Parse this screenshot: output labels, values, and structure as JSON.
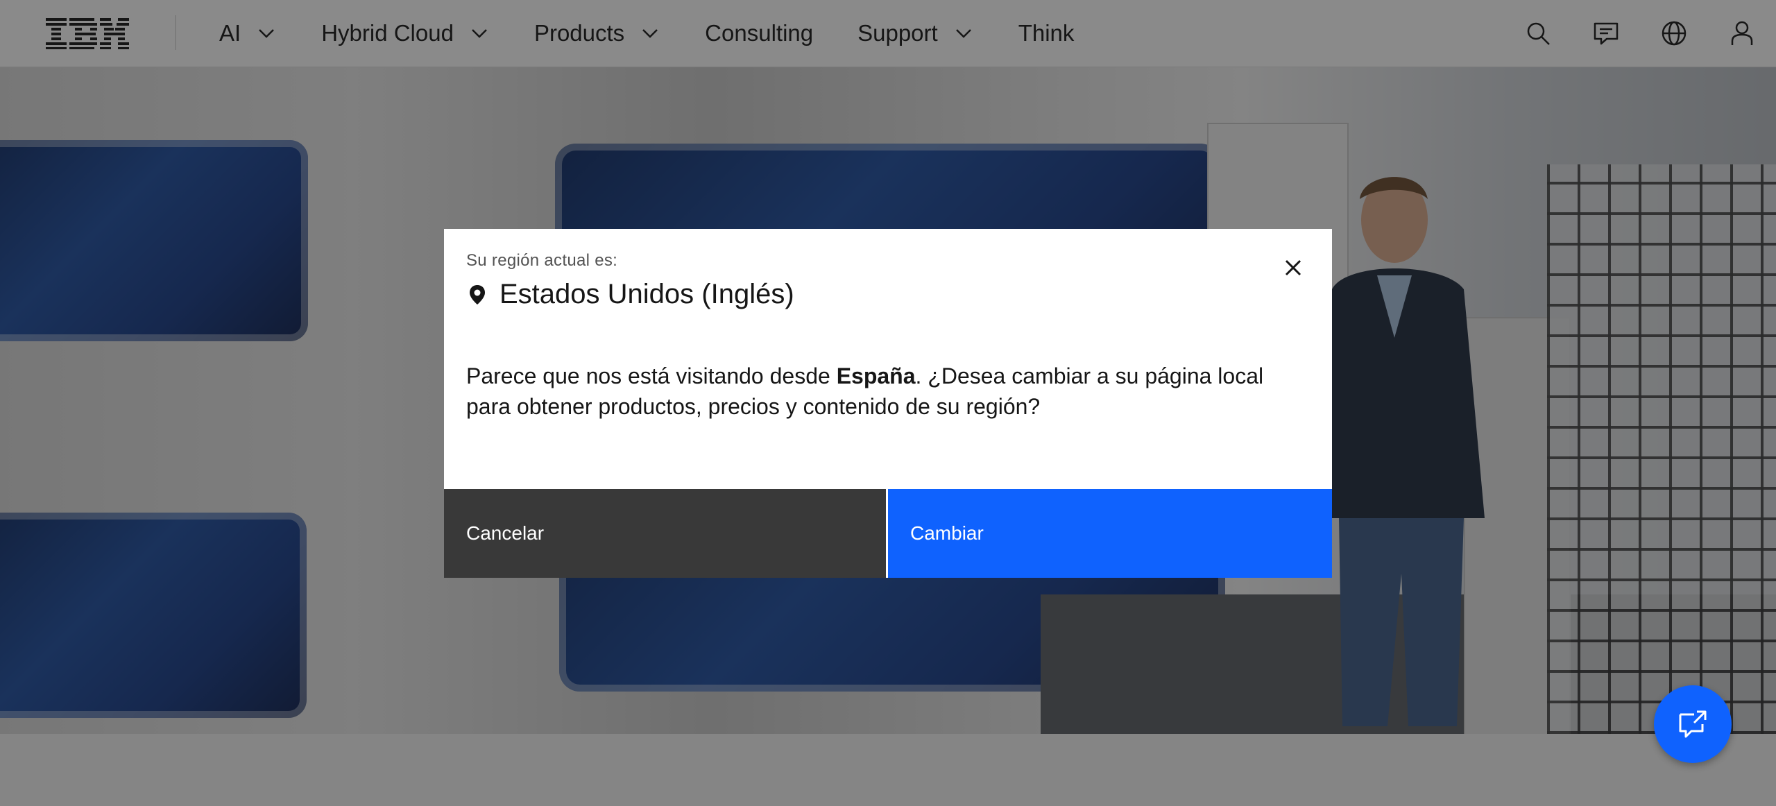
{
  "brand": {
    "logo_text": "IBM"
  },
  "nav": {
    "items": [
      {
        "label": "AI",
        "has_dropdown": true
      },
      {
        "label": "Hybrid Cloud",
        "has_dropdown": true
      },
      {
        "label": "Products",
        "has_dropdown": true
      },
      {
        "label": "Consulting",
        "has_dropdown": false
      },
      {
        "label": "Support",
        "has_dropdown": true
      },
      {
        "label": "Think",
        "has_dropdown": false
      }
    ]
  },
  "utility": {
    "icons": [
      "search-icon",
      "chat-icon",
      "globe-icon",
      "user-icon"
    ]
  },
  "modal": {
    "label": "Su región actual es:",
    "region": "Estados Unidos (Inglés)",
    "body_prefix": "Parece que nos está visitando desde ",
    "body_country": "España",
    "body_suffix": ". ¿Desea cambiar a su página local para obtener productos, precios y contenido de su región?",
    "cancel_label": "Cancelar",
    "change_label": "Cambiar"
  },
  "colors": {
    "primary": "#0f62fe",
    "secondary_button": "#393939",
    "overlay": "rgba(22,22,22,0.5)",
    "text": "#161616"
  }
}
